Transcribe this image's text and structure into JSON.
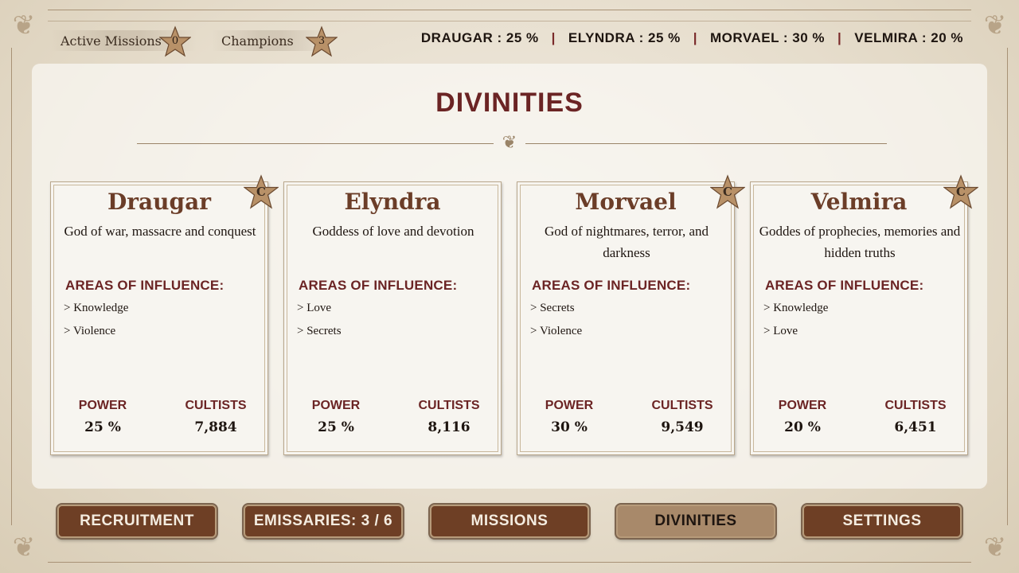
{
  "topbar": {
    "active_missions": {
      "label": "Active Missions",
      "count": "0"
    },
    "champions": {
      "label": "Champions",
      "count": "3"
    },
    "influence": [
      {
        "name": "DRAUGAR",
        "value": "DRAUGAR : 25 %"
      },
      {
        "name": "ELYNDRA",
        "value": "ELYNDRA : 25 %"
      },
      {
        "name": "MORVAEL",
        "value": "MORVAEL : 30 %"
      },
      {
        "name": "VELMIRA",
        "value": "VELMIRA : 20 %"
      }
    ],
    "separator": "|"
  },
  "panel": {
    "title": "DIVINITIES"
  },
  "cards": [
    {
      "name": "Draugar",
      "description": "God of war, massacre and conquest",
      "rank": "C",
      "areas_label": "AREAS OF INFLUENCE:",
      "areas": [
        "Knowledge",
        "Violence"
      ],
      "power_label": "POWER",
      "power": "25 %",
      "cultists_label": "CULTISTS",
      "cultists": "7,884"
    },
    {
      "name": "Elyndra",
      "description": "Goddess of love and devotion",
      "rank": "",
      "areas_label": "AREAS OF INFLUENCE:",
      "areas": [
        "Love",
        "Secrets"
      ],
      "power_label": "POWER",
      "power": "25 %",
      "cultists_label": "CULTISTS",
      "cultists": "8,116"
    },
    {
      "name": "Morvael",
      "description": "God of nightmares, terror, and darkness",
      "rank": "C",
      "areas_label": "AREAS OF INFLUENCE:",
      "areas": [
        "Secrets",
        "Violence"
      ],
      "power_label": "POWER",
      "power": "30 %",
      "cultists_label": "CULTISTS",
      "cultists": "9,549"
    },
    {
      "name": "Velmira",
      "description": "Goddes of prophecies, memories and hidden truths",
      "rank": "C",
      "areas_label": "AREAS OF INFLUENCE:",
      "areas": [
        "Knowledge",
        "Love"
      ],
      "power_label": "POWER",
      "power": "20 %",
      "cultists_label": "CULTISTS",
      "cultists": "6,451"
    }
  ],
  "nav": [
    {
      "label": "RECRUITMENT",
      "active": false
    },
    {
      "label": "EMISSARIES: 3 / 6",
      "active": false
    },
    {
      "label": "MISSIONS",
      "active": false
    },
    {
      "label": "DIVINITIES",
      "active": true
    },
    {
      "label": "SETTINGS",
      "active": false
    }
  ],
  "colors": {
    "accent": "#6b2424",
    "button": "#6e3f25",
    "button_active": "#a8896a",
    "star": "#b89168"
  },
  "icons": [
    "mission-star-icon",
    "champion-star-icon",
    "rank-star-icon",
    "corner-flourish-icon"
  ]
}
